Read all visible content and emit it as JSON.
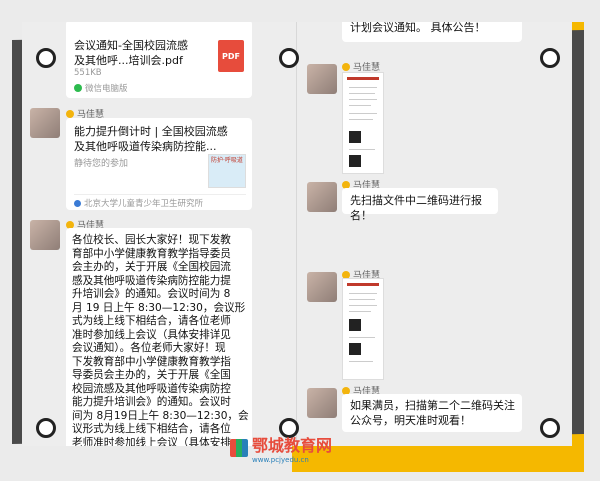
{
  "left": {
    "file_msg": {
      "title": "会议通知-全国校园流感及其他呼...培训会.pdf",
      "title_line1": "会议通知-全国校园流感",
      "title_line2": "及其他呼...培训会.pdf",
      "size": "551KB",
      "pdf_label": "PDF",
      "source": "微信电脑版"
    },
    "sender": "马佳慧",
    "link_msg": {
      "title_line1": "能力提升倒计时 | 全国校园流感",
      "title_line2": "及其他呼吸道传染病防控能...",
      "desc": "静待您的参加",
      "source": "北京大学儿童青少年卫生研究所",
      "thumb_text": "防护·呼吸道"
    },
    "long_msg": [
      "各位校长、园长大家好！现下发教",
      "育部中小学健康教育教学指导委员",
      "会主办的，关于开展《全国校园流",
      "感及其他呼吸道传染病防控能力提",
      "升培训会》的通知。会议时间为 8",
      "月 19 日上午 8:30—12:30，会议形",
      "式为线上线下相结合，请各位老师",
      "准时参加线上会议（具体安排详见",
      "会议通知）。各位老师大家好！现",
      "下发教育部中小学健康教育教学指",
      "导委员会主办的，关于开展《全国",
      "校园流感及其他呼吸道传染病防控",
      "能力提升培训会》的通知。会议时",
      "间为 8月19日上午 8:30—12:30，会",
      "议形式为线上线下相结合，请各位",
      "老师准时参加线上会议（具体安排"
    ]
  },
  "right": {
    "top_partial": "计划会议通知。 具体公告！",
    "sender": "马佳慧",
    "msg_scan": "先扫描文件中二维码进行报名！",
    "msg_full_line1": "如果满员，扫描第二个二维码关注",
    "msg_full_line2": "公众号，明天准时观看！"
  },
  "watermark": {
    "title": "鄂城教育网",
    "url": "www.pcjyedu.cn"
  },
  "colors": {
    "accent_yellow": "#f5b800",
    "pdf_red": "#e74c3c",
    "bubble": "#ffffff"
  }
}
